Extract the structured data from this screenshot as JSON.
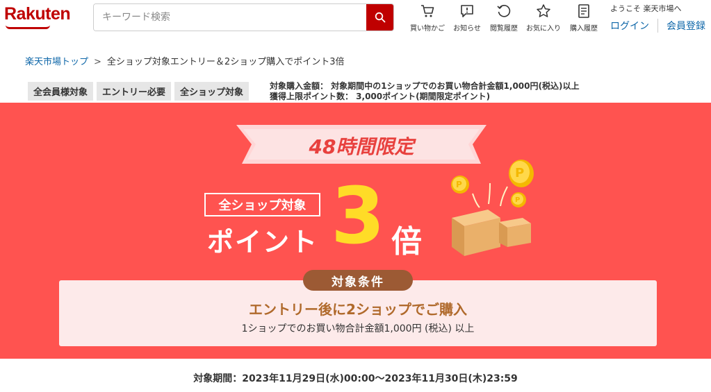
{
  "header": {
    "logo": "Rakuten",
    "search_placeholder": "キーワード検索",
    "nav": {
      "cart": "買い物かご",
      "notify": "お知らせ",
      "history": "閲覧履歴",
      "favorite": "お気に入り",
      "purchase": "購入履歴"
    },
    "welcome": "ようこそ 楽天市場へ",
    "login": "ログイン",
    "register": "会員登録"
  },
  "breadcrumb": {
    "top": "楽天市場トップ",
    "separator": ">",
    "current": "全ショップ対象エントリー＆2ショップ購入でポイント3倍"
  },
  "tags": [
    "全会員様対象",
    "エントリー必要",
    "全ショップ対象"
  ],
  "conditions": {
    "line1": "対象購入金額： 対象期間中の1ショップでのお買い物合計金額1,000円(税込)以上",
    "line2": "獲得上限ポイント数： 3,000ポイント(期間限定ポイント)"
  },
  "banner": {
    "ribbon": "48時間限定",
    "all_shop": "全ショップ対象",
    "point": "ポイント",
    "multiplier": "3",
    "bai": "倍",
    "cond_pill": "対象条件",
    "cond_main": "エントリー後に2ショップでご購入",
    "cond_sub": "1ショップでのお買い物合計金額1,000円 (税込) 以上",
    "colors": {
      "background": "#ff5350",
      "accent": "#ffdc27",
      "pill": "#9c5a34"
    }
  },
  "period": "対象期間：2023年11月29日(水)00:00～2023年11月30日(木)23:59"
}
